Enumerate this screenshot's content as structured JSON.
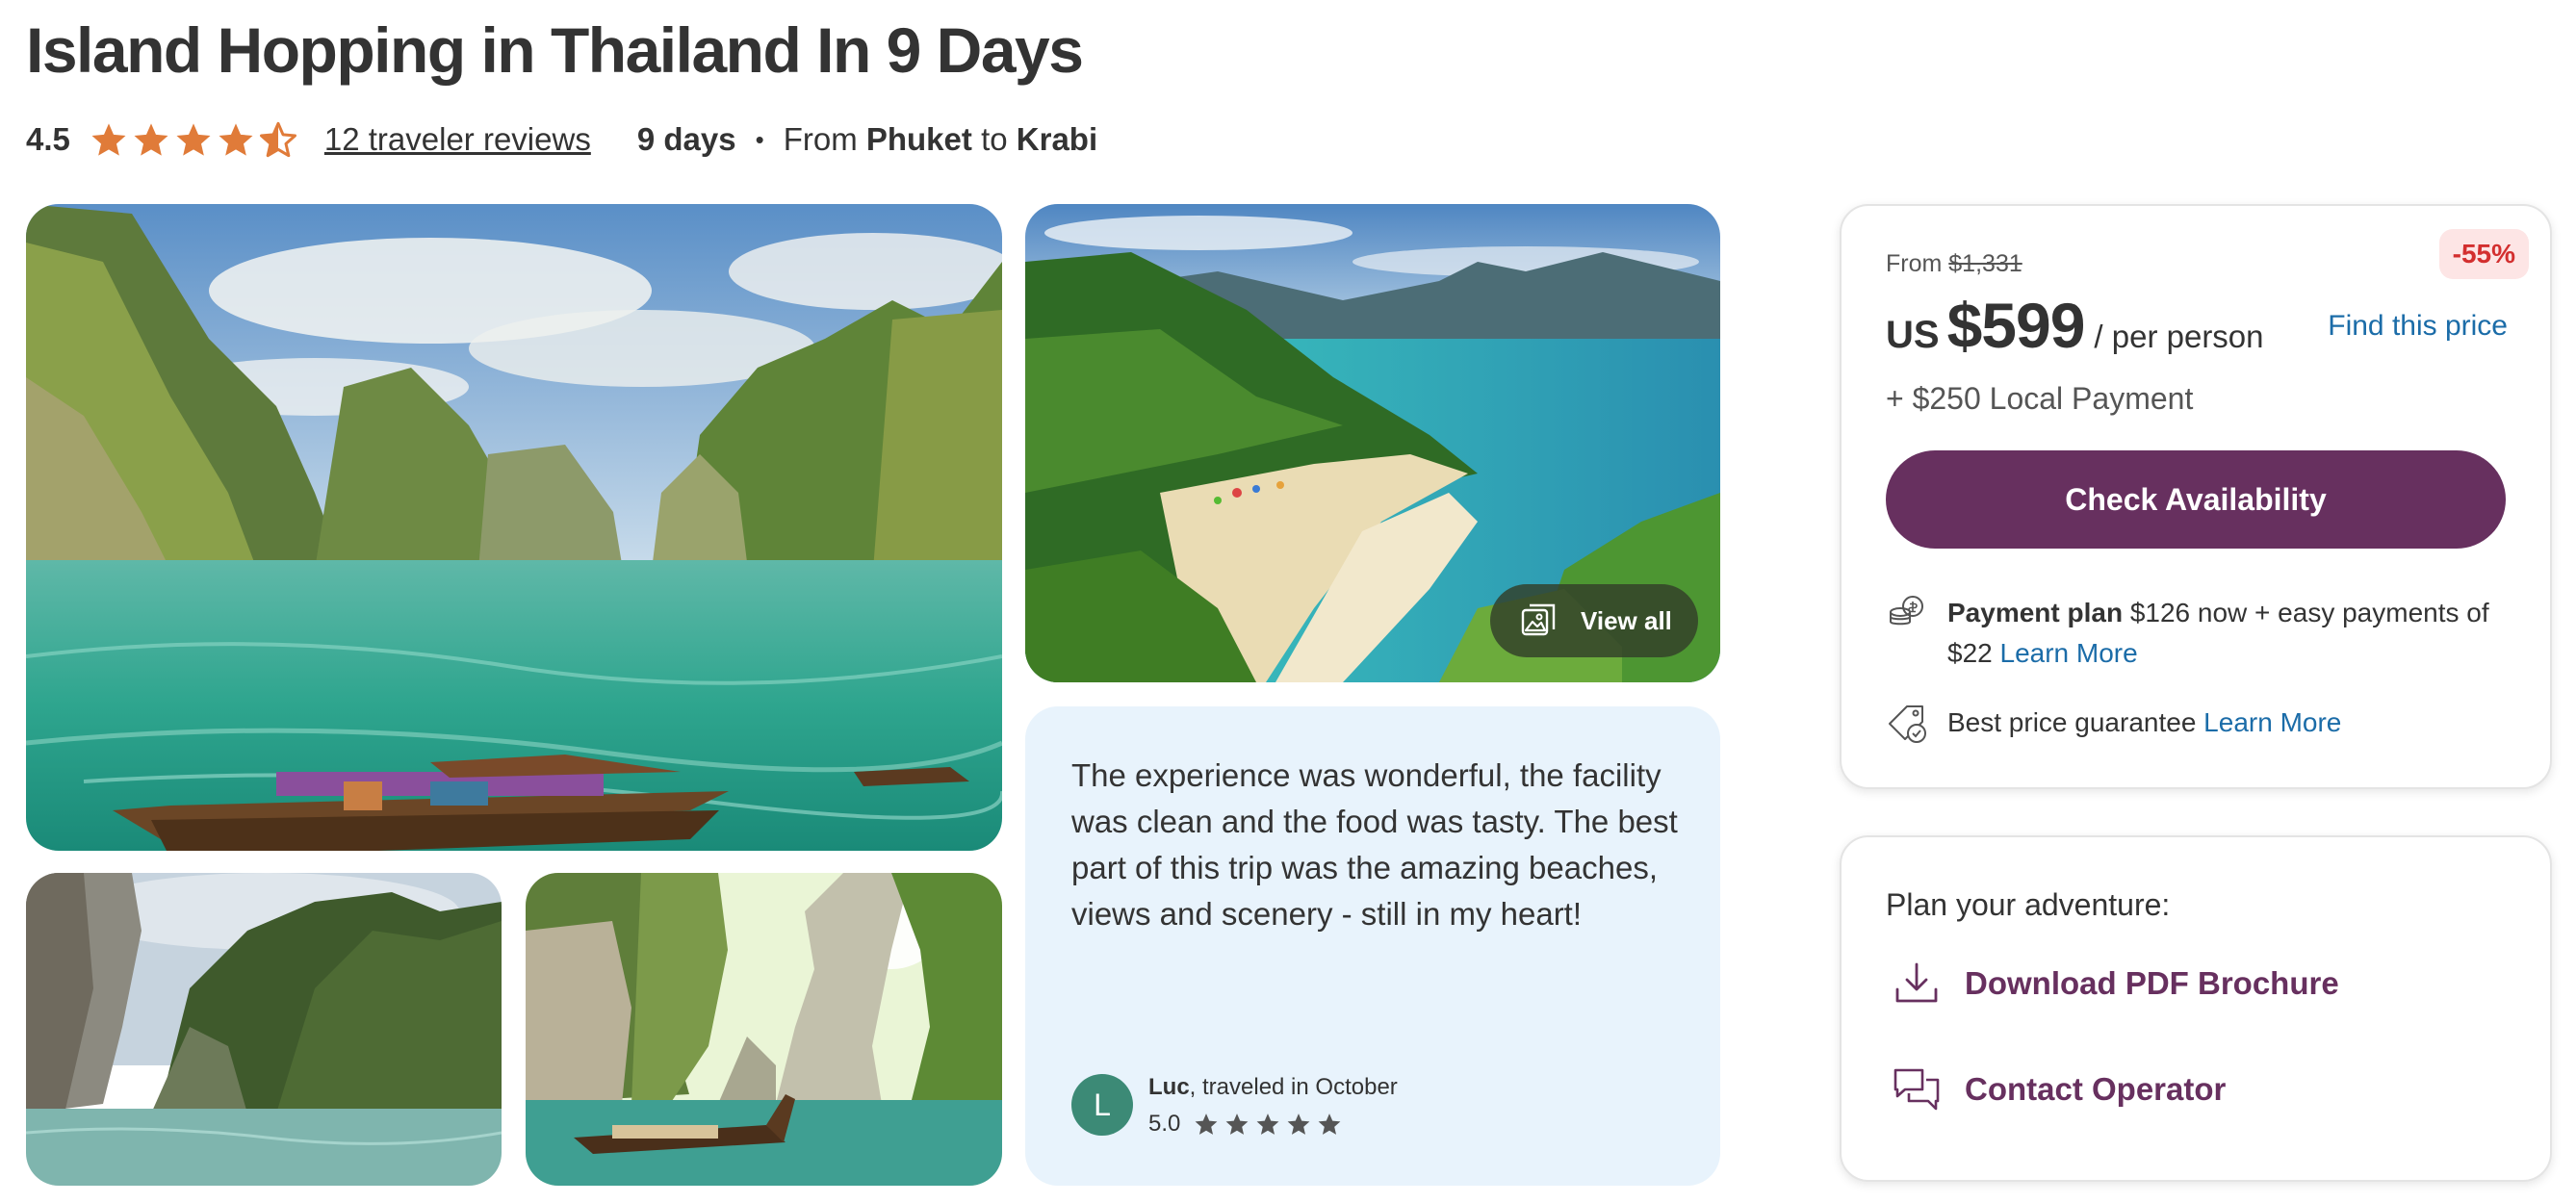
{
  "tour": {
    "title": "Island Hopping in Thailand In 9 Days",
    "rating": "4.5",
    "rating_value": 4.5,
    "reviews_link": "12 traveler reviews",
    "duration": "9 days",
    "route_from_label": "From",
    "route_from": "Phuket",
    "route_to_label": "to",
    "route_to": "Krabi"
  },
  "gallery": {
    "view_all_label": "View all"
  },
  "review": {
    "quote": "The experience was wonderful, the facility was clean and the food was tasty. The best part of this trip was the amazing beaches, views and scenery - still in my heart!",
    "avatar_initial": "L",
    "reviewer_name": "Luc",
    "reviewer_detail": ", traveled in October",
    "score": "5.0",
    "stars": 5
  },
  "pricing": {
    "from_label": "From",
    "original_price": "$1,331",
    "discount": "-55%",
    "currency": "US",
    "price": "$599",
    "per_label": "/ per person",
    "find_price_link": "Find this price",
    "local_payment": "+ $250 Local Payment",
    "cta_label": "Check Availability",
    "payment_plan_title": "Payment plan",
    "payment_plan_text": " $126 now + easy payments of $22 ",
    "payment_plan_link": "Learn More",
    "guarantee_text": "Best price guarantee ",
    "guarantee_link": "Learn More"
  },
  "adventure": {
    "heading": "Plan your adventure:",
    "download_label": "Download PDF Brochure",
    "contact_label": "Contact Operator"
  },
  "colors": {
    "brand_purple": "#67305f",
    "star_orange": "#e07b39",
    "link_blue": "#1b6ca8",
    "discount_red": "#d32f2f",
    "review_bg": "#e8f3fc",
    "avatar_green": "#3c8a76"
  },
  "icons": {
    "rating_star": "star-icon",
    "view_all": "image-gallery-icon",
    "payment_plan": "coins-icon",
    "guarantee": "price-tag-check-icon",
    "download": "download-icon",
    "contact": "chat-bubbles-icon"
  }
}
